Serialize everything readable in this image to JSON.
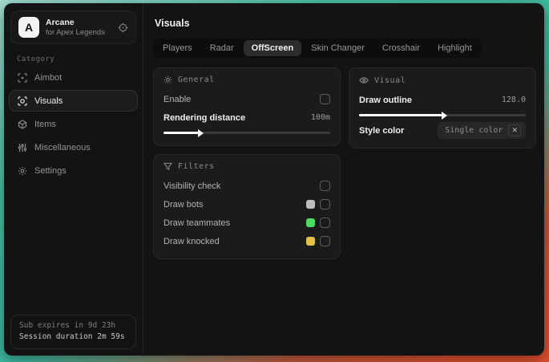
{
  "app": {
    "logo_letter": "A",
    "name": "Arcane",
    "subtitle": "for Apex Legends"
  },
  "sidebar": {
    "category_label": "Category",
    "items": [
      {
        "label": "Aimbot"
      },
      {
        "label": "Visuals"
      },
      {
        "label": "Items"
      },
      {
        "label": "Miscellaneous"
      },
      {
        "label": "Settings"
      }
    ],
    "footer": {
      "sub_expires": "Sub expires in 9d 23h",
      "session_duration": "Session duration 2m 59s"
    }
  },
  "main": {
    "title": "Visuals",
    "tabs": [
      {
        "label": "Players"
      },
      {
        "label": "Radar"
      },
      {
        "label": "OffScreen"
      },
      {
        "label": "Skin Changer"
      },
      {
        "label": "Crosshair"
      },
      {
        "label": "Highlight"
      }
    ],
    "general": {
      "title": "General",
      "enable_label": "Enable",
      "distance_label": "Rendering distance",
      "distance_value": "100m",
      "distance_fill": "21%"
    },
    "filters": {
      "title": "Filters",
      "rows": [
        {
          "label": "Visibility check",
          "swatch": ""
        },
        {
          "label": "Draw bots",
          "swatch": "#bcbcbc"
        },
        {
          "label": "Draw teammates",
          "swatch": "#4cd964"
        },
        {
          "label": "Draw knocked",
          "swatch": "#e2c04c"
        }
      ]
    },
    "visual": {
      "title": "Visual",
      "outline_label": "Draw outline",
      "outline_value": "128.0",
      "outline_fill": "50%",
      "style_label": "Style color",
      "style_value": "Single color",
      "style_clear": "✕"
    }
  }
}
